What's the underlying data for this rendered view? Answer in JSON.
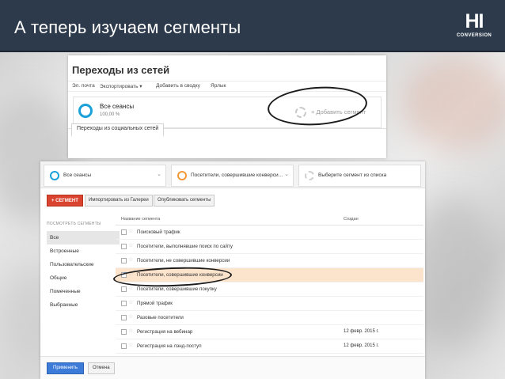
{
  "slide": {
    "title": "А теперь изучаем сегменты",
    "logo": {
      "main": "HI",
      "sub": "CONVERSION"
    }
  },
  "top_panel": {
    "title": "Переходы из сетей",
    "toolbar": [
      "Эл. почта",
      "Экспортировать ▾",
      "Добавить в сводку",
      "Ярлык"
    ],
    "segment": {
      "name": "Все сеансы",
      "percent": "100,00 %"
    },
    "add_segment_label": "+ Добавить сегмент",
    "tab_label": "Переходы из социальных сетей"
  },
  "segment_picker": {
    "chips": [
      {
        "label": "Все сеансы",
        "ring": "blue"
      },
      {
        "label": "Посетители, совершившие конверси...",
        "ring": "orange"
      },
      {
        "label": "Выберите сегмент из списка",
        "ring": "gray"
      }
    ],
    "buttons": {
      "new_segment": "+ СЕГМЕНТ",
      "import_gallery": "Импортировать из Галереи",
      "shared_segments": "Опубликовать сегменты"
    },
    "sidebar": {
      "heading": "ПОСМОТРЕТЬ СЕГМЕНТЫ",
      "items": [
        "Все",
        "Встроенные",
        "Пользовательские",
        "Общие",
        "Помеченные",
        "Выбранные"
      ],
      "active_index": 0
    },
    "table": {
      "headers": {
        "name": "Название сегмента",
        "created": "Создан"
      },
      "rows": [
        {
          "name": "Поисковый трафик",
          "date": "",
          "checked": false
        },
        {
          "name": "Посетители, выполнявшие поиск по сайту",
          "date": "",
          "checked": false
        },
        {
          "name": "Посетители, не совершившие конверсии",
          "date": "",
          "checked": false
        },
        {
          "name": "Посетители, совершившие конверсии",
          "date": "",
          "checked": true
        },
        {
          "name": "Посетители, совершившие покупку",
          "date": "",
          "checked": false
        },
        {
          "name": "Прямой трафик",
          "date": "",
          "checked": false
        },
        {
          "name": "Разовые посетители",
          "date": "",
          "checked": false
        },
        {
          "name": "Регистрация на вебинар",
          "date": "12 февр. 2015 г.",
          "checked": false
        },
        {
          "name": "Регистрация на лэнд-поступ",
          "date": "12 февр. 2015 г.",
          "checked": false
        }
      ]
    },
    "footer": {
      "apply": "Применить",
      "cancel": "Отмена"
    }
  },
  "colors": {
    "title_bar": "#2d3a4b",
    "ring_blue": "#1ba1d8",
    "ring_orange": "#f29a3a",
    "primary_red": "#d9432f",
    "apply_blue": "#3d7bd9",
    "selected_row": "#fbe3cc"
  }
}
